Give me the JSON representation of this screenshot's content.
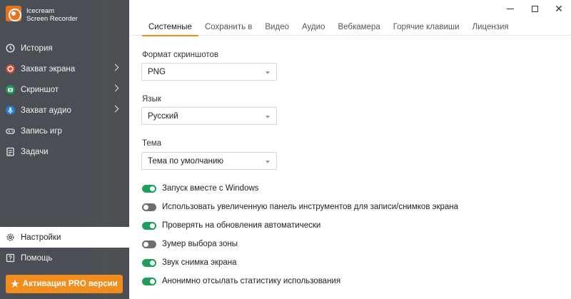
{
  "app": {
    "title_line1": "Icecream",
    "title_line2": "Screen Recorder"
  },
  "sidebar": {
    "items": [
      {
        "label": "История",
        "icon": "history-icon",
        "color": "#e0e0e0"
      },
      {
        "label": "Захват экрана",
        "icon": "record-icon",
        "color": "#e04a2e"
      },
      {
        "label": "Скриншот",
        "icon": "camera-icon",
        "color": "#1e9e5a"
      },
      {
        "label": "Захват аудио",
        "icon": "microphone-icon",
        "color": "#2a7fd8"
      },
      {
        "label": "Запись игр",
        "icon": "gamepad-icon",
        "color": "#e0e0e0"
      },
      {
        "label": "Задачи",
        "icon": "tasks-icon",
        "color": "#e0e0e0"
      }
    ],
    "bottom": [
      {
        "label": "Настройки",
        "icon": "gear-icon"
      },
      {
        "label": "Помощь",
        "icon": "help-icon"
      }
    ],
    "pro_button": "Активация PRO версии"
  },
  "tabs": [
    "Системные",
    "Сохранить в",
    "Видео",
    "Аудио",
    "Вебкамера",
    "Горячие клавиши",
    "Лицензия"
  ],
  "settings": {
    "format": {
      "label": "Формат скриншотов",
      "value": "PNG"
    },
    "language": {
      "label": "Язык",
      "value": "Русский"
    },
    "theme": {
      "label": "Тема",
      "value": "Тема по умолчанию"
    },
    "toggles": [
      {
        "label": "Запуск вместе с Windows",
        "on": true
      },
      {
        "label": "Использовать увеличенную панель инструментов для записи/снимков экрана",
        "on": false
      },
      {
        "label": "Проверять на обновления автоматически",
        "on": true
      },
      {
        "label": "Зумер выбора зоны",
        "on": false
      },
      {
        "label": "Звук снимка экрана",
        "on": true
      },
      {
        "label": "Анонимно отсылать статистику использования",
        "on": true
      }
    ]
  },
  "colors": {
    "accent": "#f28c1b",
    "toggle_on": "#1e9e5a",
    "toggle_off": "#6d6d6d",
    "sidebar_bg": "#4a4f56"
  }
}
